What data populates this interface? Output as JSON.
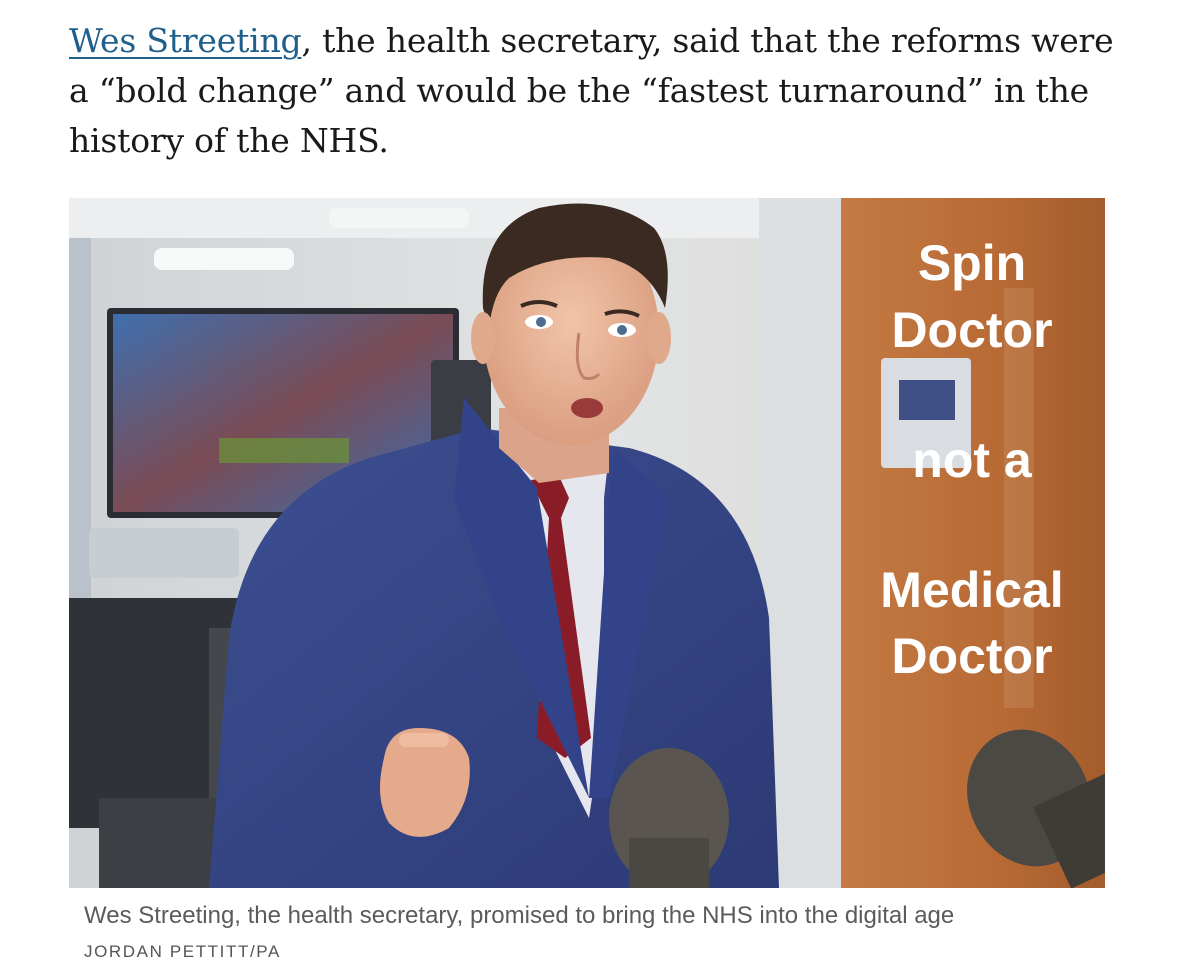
{
  "article": {
    "link_text": "Wes Streeting",
    "sentence_rest": ", the health secretary, said that the reforms were a “bold change” and would be the “fastest turnaround” in the history of the NHS.",
    "link_color": "#1f5f8b"
  },
  "image": {
    "overlay_lines": [
      "Spin",
      "Doctor",
      "not a",
      "Medical",
      "Doctor"
    ],
    "overlay_color": "#ffffff"
  },
  "caption": {
    "text": "Wes Streeting, the health secretary, promised to bring the NHS into the digital age",
    "credit": "JORDAN PETTITT/PA"
  }
}
